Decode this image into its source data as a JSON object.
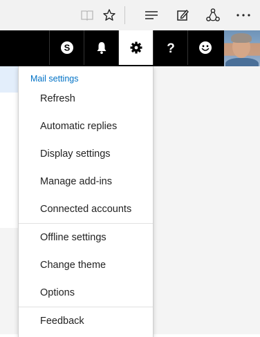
{
  "browser_toolbar": {
    "icons": [
      "reading-view-icon",
      "favorites-star-icon",
      "hub-icon",
      "web-note-icon",
      "share-icon",
      "more-icon"
    ]
  },
  "app_bar": {
    "buttons": [
      "skype-icon",
      "notifications-bell-icon",
      "settings-gear-icon",
      "help-icon",
      "feedback-smiley-icon"
    ],
    "active_button": "settings-gear-icon",
    "colors": {
      "background": "#000000",
      "icon": "#ffffff",
      "active_background": "#ffffff"
    }
  },
  "settings_menu": {
    "title": "Mail settings",
    "title_color": "#0072c6",
    "items": [
      {
        "label": "Refresh"
      },
      {
        "label": "Automatic replies"
      },
      {
        "label": "Display settings"
      },
      {
        "label": "Manage add-ins"
      },
      {
        "label": "Connected accounts"
      },
      {
        "label": "Offline settings"
      },
      {
        "label": "Change theme"
      },
      {
        "label": "Options"
      },
      {
        "label": "Feedback"
      }
    ]
  }
}
